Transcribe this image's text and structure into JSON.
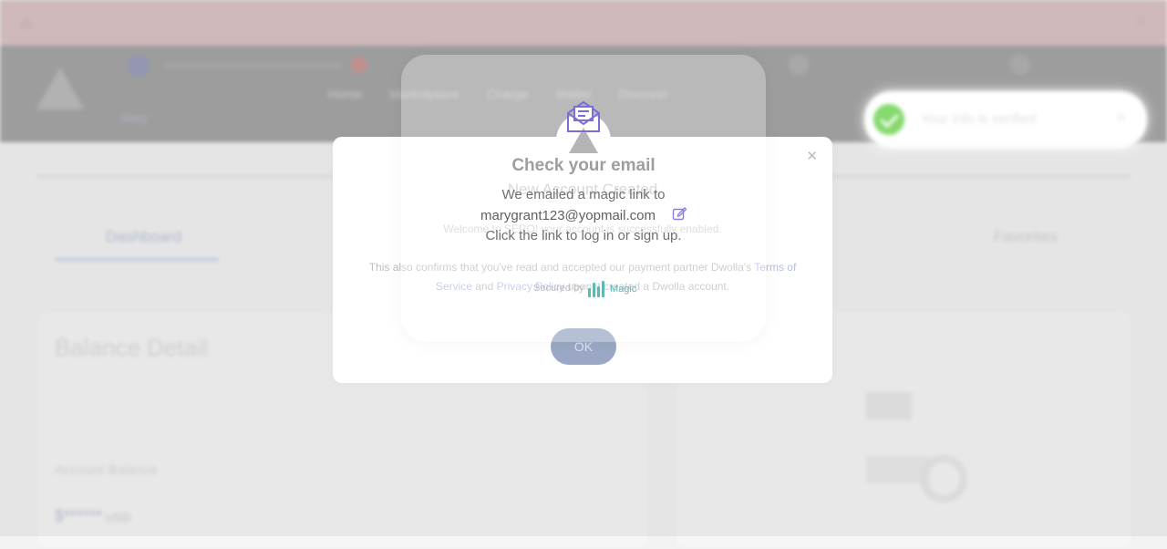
{
  "background": {
    "user_label": "Mary",
    "nav_items": [
      "Home",
      "Marketplace",
      "Charge",
      "Wallet",
      "Discover"
    ],
    "tabs": {
      "dashboard": "Dashboard",
      "favorites": "Favorites"
    },
    "balance_title": "Balance Detail",
    "account_balance_label": "Account Balance",
    "account_balance_value": "$******",
    "currency": "USD"
  },
  "account_modal": {
    "title": "New Account Created",
    "welcome": "Welcome to SERO! your account is successfully enabled.",
    "confirm_prefix": "This also confirms that you've read and accepted our payment partner Dwolla's",
    "terms_link": "Terms of Service",
    "and": "and",
    "privacy_link": "Privacy Policy",
    "confirm_suffix": "upon it created a Dwolla account.",
    "ok_label": "OK"
  },
  "magic_modal": {
    "title": "Check your email",
    "line1": "We emailed a magic link to",
    "email": "marygrant123@yopmail.com",
    "line3": "Click the link to log in or sign up.",
    "secured_by": "Secured by",
    "brand": "Magic"
  },
  "toast": {
    "message": "Your info is verified"
  }
}
